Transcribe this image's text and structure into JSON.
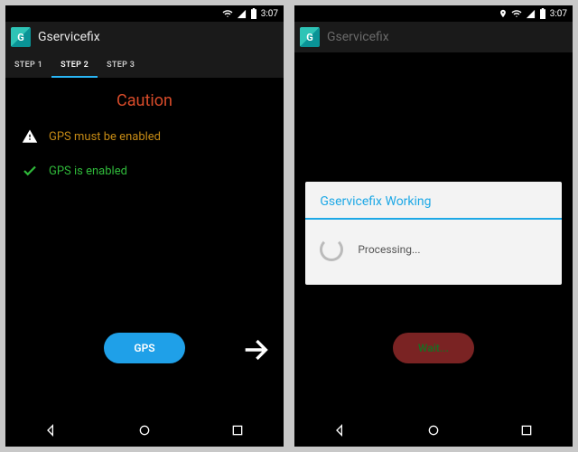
{
  "status": {
    "time": "3:07"
  },
  "app": {
    "title": "Gservicefix",
    "icon_letter": "G"
  },
  "tabs": [
    {
      "label": "STEP 1",
      "active": false
    },
    {
      "label": "STEP 2",
      "active": true
    },
    {
      "label": "STEP 3",
      "active": false
    }
  ],
  "left": {
    "caution": "Caution",
    "warn_msg": "GPS  must be enabled",
    "ok_msg": "GPS is enabled",
    "button_label": "GPS"
  },
  "right": {
    "dialog_title": "Gservicefix Working",
    "dialog_msg": "Processing...",
    "button_label": "Wait..."
  }
}
